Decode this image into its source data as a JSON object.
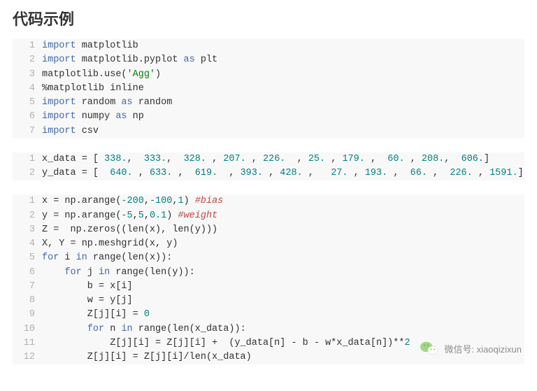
{
  "heading": "代码示例",
  "blocks": [
    {
      "lines": [
        {
          "n": "1",
          "segments": [
            {
              "t": "import",
              "c": "kw"
            },
            {
              "t": " matplotlib",
              "c": "mod"
            }
          ]
        },
        {
          "n": "2",
          "segments": [
            {
              "t": "import",
              "c": "kw"
            },
            {
              "t": " matplotlib.pyplot ",
              "c": "mod"
            },
            {
              "t": "as",
              "c": "kw"
            },
            {
              "t": " plt",
              "c": "mod"
            }
          ]
        },
        {
          "n": "3",
          "segments": [
            {
              "t": "matplotlib.use(",
              "c": "mod"
            },
            {
              "t": "'Agg'",
              "c": "str"
            },
            {
              "t": ")",
              "c": "mod"
            }
          ]
        },
        {
          "n": "4",
          "segments": [
            {
              "t": "%matplotlib inline",
              "c": "mod"
            }
          ]
        },
        {
          "n": "5",
          "segments": [
            {
              "t": "import",
              "c": "kw"
            },
            {
              "t": " random ",
              "c": "mod"
            },
            {
              "t": "as",
              "c": "kw"
            },
            {
              "t": " random",
              "c": "mod"
            }
          ]
        },
        {
          "n": "6",
          "segments": [
            {
              "t": "import",
              "c": "kw"
            },
            {
              "t": " numpy ",
              "c": "mod"
            },
            {
              "t": "as",
              "c": "kw"
            },
            {
              "t": " np",
              "c": "mod"
            }
          ]
        },
        {
          "n": "7",
          "segments": [
            {
              "t": "import",
              "c": "kw"
            },
            {
              "t": " csv",
              "c": "mod"
            }
          ]
        }
      ]
    },
    {
      "lines": [
        {
          "n": "1",
          "segments": [
            {
              "t": "x_data = [ ",
              "c": "mod"
            },
            {
              "t": "338.",
              "c": "num"
            },
            {
              "t": ",  ",
              "c": "mod"
            },
            {
              "t": "333.",
              "c": "num"
            },
            {
              "t": ",  ",
              "c": "mod"
            },
            {
              "t": "328.",
              "c": "num"
            },
            {
              "t": " , ",
              "c": "mod"
            },
            {
              "t": "207.",
              "c": "num"
            },
            {
              "t": " , ",
              "c": "mod"
            },
            {
              "t": "226.",
              "c": "num"
            },
            {
              "t": "  , ",
              "c": "mod"
            },
            {
              "t": "25.",
              "c": "num"
            },
            {
              "t": " , ",
              "c": "mod"
            },
            {
              "t": "179.",
              "c": "num"
            },
            {
              "t": " ,  ",
              "c": "mod"
            },
            {
              "t": "60.",
              "c": "num"
            },
            {
              "t": " , ",
              "c": "mod"
            },
            {
              "t": "208.",
              "c": "num"
            },
            {
              "t": ",  ",
              "c": "mod"
            },
            {
              "t": "606.",
              "c": "num"
            },
            {
              "t": "]",
              "c": "mod"
            }
          ]
        },
        {
          "n": "2",
          "segments": [
            {
              "t": "y_data = [  ",
              "c": "mod"
            },
            {
              "t": "640.",
              "c": "num"
            },
            {
              "t": " , ",
              "c": "mod"
            },
            {
              "t": "633.",
              "c": "num"
            },
            {
              "t": " ,  ",
              "c": "mod"
            },
            {
              "t": "619.",
              "c": "num"
            },
            {
              "t": "  , ",
              "c": "mod"
            },
            {
              "t": "393.",
              "c": "num"
            },
            {
              "t": " , ",
              "c": "mod"
            },
            {
              "t": "428.",
              "c": "num"
            },
            {
              "t": " ,   ",
              "c": "mod"
            },
            {
              "t": "27.",
              "c": "num"
            },
            {
              "t": " , ",
              "c": "mod"
            },
            {
              "t": "193.",
              "c": "num"
            },
            {
              "t": " ,  ",
              "c": "mod"
            },
            {
              "t": "66.",
              "c": "num"
            },
            {
              "t": " ,  ",
              "c": "mod"
            },
            {
              "t": "226.",
              "c": "num"
            },
            {
              "t": " , ",
              "c": "mod"
            },
            {
              "t": "1591.",
              "c": "num"
            },
            {
              "t": "]",
              "c": "mod"
            }
          ]
        }
      ]
    },
    {
      "lines": [
        {
          "n": "1",
          "segments": [
            {
              "t": "x = np.arange(",
              "c": "mod"
            },
            {
              "t": "-200",
              "c": "num"
            },
            {
              "t": ",",
              "c": "mod"
            },
            {
              "t": "-100",
              "c": "num"
            },
            {
              "t": ",",
              "c": "mod"
            },
            {
              "t": "1",
              "c": "num"
            },
            {
              "t": ") ",
              "c": "mod"
            },
            {
              "t": "#bias",
              "c": "cmt"
            }
          ]
        },
        {
          "n": "2",
          "segments": [
            {
              "t": "y = np.arange(",
              "c": "mod"
            },
            {
              "t": "-5",
              "c": "num"
            },
            {
              "t": ",",
              "c": "mod"
            },
            {
              "t": "5",
              "c": "num"
            },
            {
              "t": ",",
              "c": "mod"
            },
            {
              "t": "0.1",
              "c": "num"
            },
            {
              "t": ") ",
              "c": "mod"
            },
            {
              "t": "#weight",
              "c": "cmt"
            }
          ]
        },
        {
          "n": "3",
          "segments": [
            {
              "t": "Z =  np.zeros((len(x), len(y)))",
              "c": "mod"
            }
          ]
        },
        {
          "n": "4",
          "segments": [
            {
              "t": "X, Y = np.meshgrid(x, y)",
              "c": "mod"
            }
          ]
        },
        {
          "n": "5",
          "segments": [
            {
              "t": "for",
              "c": "kw"
            },
            {
              "t": " i ",
              "c": "mod"
            },
            {
              "t": "in",
              "c": "kw"
            },
            {
              "t": " range(len(x)):",
              "c": "mod"
            }
          ]
        },
        {
          "n": "6",
          "segments": [
            {
              "t": "    ",
              "c": "mod"
            },
            {
              "t": "for",
              "c": "kw"
            },
            {
              "t": " j ",
              "c": "mod"
            },
            {
              "t": "in",
              "c": "kw"
            },
            {
              "t": " range(len(y)):",
              "c": "mod"
            }
          ]
        },
        {
          "n": "7",
          "segments": [
            {
              "t": "        b = x[i]",
              "c": "mod"
            }
          ]
        },
        {
          "n": "8",
          "segments": [
            {
              "t": "        w = y[j]",
              "c": "mod"
            }
          ]
        },
        {
          "n": "9",
          "segments": [
            {
              "t": "        Z[j][i] = ",
              "c": "mod"
            },
            {
              "t": "0",
              "c": "num"
            }
          ]
        },
        {
          "n": "10",
          "segments": [
            {
              "t": "        ",
              "c": "mod"
            },
            {
              "t": "for",
              "c": "kw"
            },
            {
              "t": " n ",
              "c": "mod"
            },
            {
              "t": "in",
              "c": "kw"
            },
            {
              "t": " range(len(x_data)):",
              "c": "mod"
            }
          ]
        },
        {
          "n": "11",
          "segments": [
            {
              "t": "            Z[j][i] = Z[j][i] +  (y_data[n] - b - w*x_data[n])**",
              "c": "mod"
            },
            {
              "t": "2",
              "c": "num"
            }
          ]
        },
        {
          "n": "12",
          "segments": [
            {
              "t": "        Z[j][i] = Z[j][i]/len(x_data)",
              "c": "mod"
            }
          ]
        }
      ]
    }
  ],
  "watermark": {
    "label": "微信号: xiaoqizixun"
  }
}
